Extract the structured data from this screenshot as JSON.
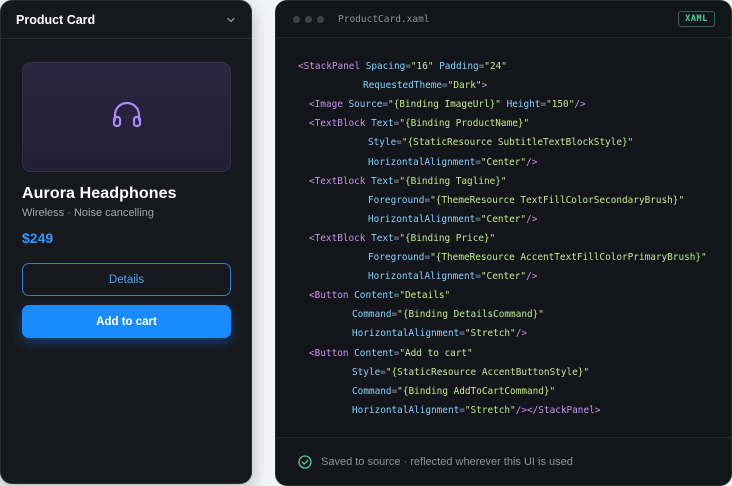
{
  "card": {
    "header_title": "Product Card",
    "product_name": "Aurora Headphones",
    "tagline": "Wireless · Noise cancelling",
    "price": "$249",
    "details_label": "Details",
    "add_to_cart_label": "Add to cart",
    "hero_icon": "headphones-icon",
    "accent_color": "#1a8cff"
  },
  "editor": {
    "filename": "ProductCard.xaml",
    "language_badge": "XAML",
    "code_lines": [
      [
        [
          "tag",
          "<StackPanel "
        ],
        [
          "attr",
          "Spacing"
        ],
        [
          "eq",
          "="
        ],
        [
          "str",
          "\"16\""
        ],
        [
          "attr",
          " Padding"
        ],
        [
          "eq",
          "="
        ],
        [
          "str",
          "\"24\""
        ]
      ],
      [
        [
          "attr",
          "RequestedTheme"
        ],
        [
          "eq",
          "="
        ],
        [
          "str",
          "\"Dark\""
        ],
        [
          "tag",
          ">"
        ]
      ],
      [
        [
          "tag",
          "<Image "
        ],
        [
          "attr",
          "Source"
        ],
        [
          "eq",
          "="
        ],
        [
          "str",
          "\"{Binding ImageUrl}\""
        ],
        [
          "attr",
          " Height"
        ],
        [
          "eq",
          "="
        ],
        [
          "str",
          "\"150\""
        ],
        [
          "tag",
          "/>"
        ]
      ],
      [
        [
          "tag",
          "<TextBlock "
        ],
        [
          "attr",
          "Text"
        ],
        [
          "eq",
          "="
        ],
        [
          "str",
          "\"{Binding ProductName}\""
        ]
      ],
      [
        [
          "attr",
          "Style"
        ],
        [
          "eq",
          "="
        ],
        [
          "str",
          "\"{StaticResource SubtitleTextBlockStyle}\""
        ]
      ],
      [
        [
          "attr",
          "HorizontalAlignment"
        ],
        [
          "eq",
          "="
        ],
        [
          "str",
          "\"Center\""
        ],
        [
          "tag",
          "/>"
        ]
      ],
      [
        [
          "tag",
          "<TextBlock "
        ],
        [
          "attr",
          "Text"
        ],
        [
          "eq",
          "="
        ],
        [
          "str",
          "\"{Binding Tagline}\""
        ]
      ],
      [
        [
          "attr",
          "Foreground"
        ],
        [
          "eq",
          "="
        ],
        [
          "str",
          "\"{ThemeResource TextFillColorSecondaryBrush}\""
        ]
      ],
      [
        [
          "attr",
          "HorizontalAlignment"
        ],
        [
          "eq",
          "="
        ],
        [
          "str",
          "\"Center\""
        ],
        [
          "tag",
          "/>"
        ]
      ],
      [
        [
          "tag",
          "<TextBlock "
        ],
        [
          "attr",
          "Text"
        ],
        [
          "eq",
          "="
        ],
        [
          "str",
          "\"{Binding Price}\""
        ]
      ],
      [
        [
          "attr",
          "Foreground"
        ],
        [
          "eq",
          "="
        ],
        [
          "str",
          "\"{ThemeResource AccentTextFillColorPrimaryBrush}\""
        ]
      ],
      [
        [
          "attr",
          "HorizontalAlignment"
        ],
        [
          "eq",
          "="
        ],
        [
          "str",
          "\"Center\""
        ],
        [
          "tag",
          "/>"
        ]
      ],
      [
        [
          "tag",
          "<Button "
        ],
        [
          "attr",
          "Content"
        ],
        [
          "eq",
          "="
        ],
        [
          "str",
          "\"Details\""
        ]
      ],
      [
        [
          "attr",
          "Command"
        ],
        [
          "eq",
          "="
        ],
        [
          "str",
          "\"{Binding DetailsCommand}\""
        ]
      ],
      [
        [
          "attr",
          "HorizontalAlignment"
        ],
        [
          "eq",
          "="
        ],
        [
          "str",
          "\"Stretch\""
        ],
        [
          "tag",
          "/>"
        ]
      ],
      [
        [
          "tag",
          "<Button "
        ],
        [
          "attr",
          "Content"
        ],
        [
          "eq",
          "="
        ],
        [
          "str",
          "\"Add to cart\""
        ]
      ],
      [
        [
          "attr",
          "Style"
        ],
        [
          "eq",
          "="
        ],
        [
          "str",
          "\"{StaticResource AccentButtonStyle}\""
        ]
      ],
      [
        [
          "attr",
          "Command"
        ],
        [
          "eq",
          "="
        ],
        [
          "str",
          "\"{Binding AddToCartCommand}\""
        ]
      ],
      [
        [
          "attr",
          "HorizontalAlignment"
        ],
        [
          "eq",
          "="
        ],
        [
          "str",
          "\"Stretch\""
        ],
        [
          "tag",
          "/></StackPanel>"
        ]
      ]
    ],
    "footer_text": "Saved to source · reflected wherever this UI is used",
    "footer_icon": "check-circle-icon",
    "colors": {
      "tag": "#c792ea",
      "attr": "#7fd3ff",
      "string": "#c3e88d",
      "badge": "#4fd39a"
    }
  }
}
